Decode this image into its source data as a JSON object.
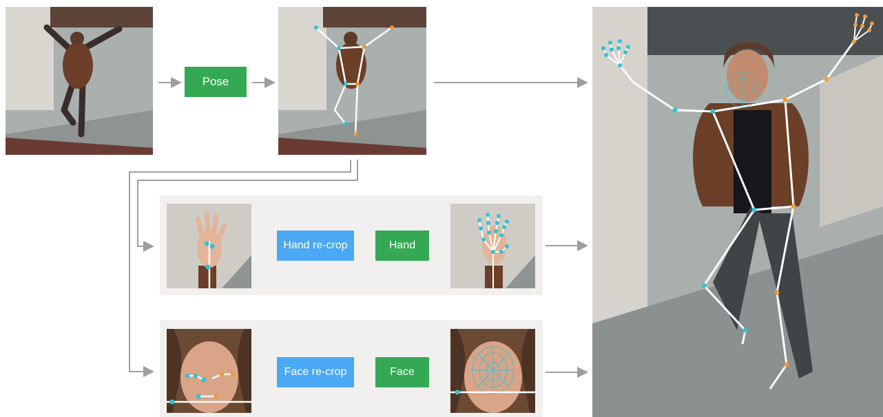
{
  "diagram": {
    "pose_label": "Pose",
    "hand_recrop_label": "Hand re-crop",
    "hand_label": "Hand",
    "face_recrop_label": "Face re-crop",
    "face_label": "Face"
  },
  "colors": {
    "model_box": "#34a853",
    "recrop_box": "#4aa8f5",
    "connector": "#9e9e9e",
    "panel_bg": "#f1f0ee",
    "skeleton": "#ffffff",
    "keypoint_cyan": "#33c2d6",
    "keypoint_orange": "#f29a38"
  },
  "icons": {
    "input_photo": "person-photo",
    "pose_result": "pose-skeleton-photo",
    "hand_crop": "hand-photo",
    "hand_result": "hand-landmarks-photo",
    "face_crop": "face-photo",
    "face_result": "face-mesh-photo",
    "final_result": "holistic-landmarks-photo"
  }
}
